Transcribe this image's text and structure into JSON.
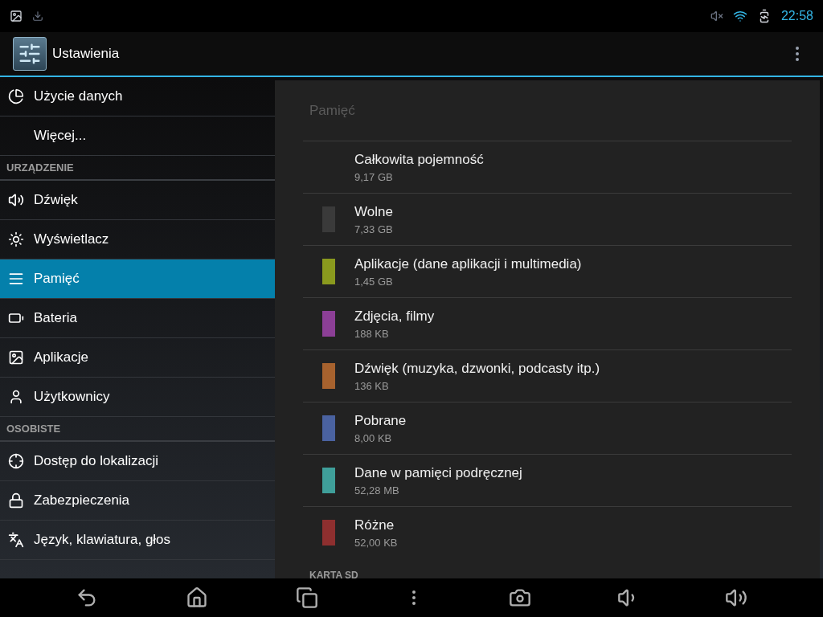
{
  "status_bar": {
    "time": "22:58"
  },
  "action_bar": {
    "title": "Ustawienia"
  },
  "sidebar": {
    "items": [
      {
        "kind": "item",
        "label": "Użycie danych",
        "selected": false
      },
      {
        "kind": "item",
        "label": "Więcej...",
        "selected": false
      },
      {
        "kind": "header",
        "label": "URZĄDZENIE"
      },
      {
        "kind": "item",
        "label": "Dźwięk",
        "selected": false
      },
      {
        "kind": "item",
        "label": "Wyświetlacz",
        "selected": false
      },
      {
        "kind": "item",
        "label": "Pamięć",
        "selected": true
      },
      {
        "kind": "item",
        "label": "Bateria",
        "selected": false
      },
      {
        "kind": "item",
        "label": "Aplikacje",
        "selected": false
      },
      {
        "kind": "item",
        "label": "Użytkownicy",
        "selected": false
      },
      {
        "kind": "header",
        "label": "OSOBISTE"
      },
      {
        "kind": "item",
        "label": "Dostęp do lokalizacji",
        "selected": false
      },
      {
        "kind": "item",
        "label": "Zabezpieczenia",
        "selected": false
      },
      {
        "kind": "item",
        "label": "Język, klawiatura, głos",
        "selected": false
      }
    ]
  },
  "storage": {
    "title": "Pamięć",
    "rows": [
      {
        "label": "Całkowita pojemność",
        "value": "9,17 GB"
      },
      {
        "label": "Wolne",
        "value": "7,33 GB",
        "color": "#3a3a3a"
      },
      {
        "label": "Aplikacje (dane aplikacji i multimedia)",
        "value": "1,45 GB",
        "color": "#8a9a1e"
      },
      {
        "label": "Zdjęcia, filmy",
        "value": "188 KB",
        "color": "#8c3f96"
      },
      {
        "label": "Dźwięk (muzyka, dzwonki, podcasty itp.)",
        "value": "136 KB",
        "color": "#a7622e"
      },
      {
        "label": "Pobrane",
        "value": "8,00 KB",
        "color": "#4a62a0"
      },
      {
        "label": "Dane w pamięci podręcznej",
        "value": "52,28 MB",
        "color": "#3f9f9a"
      },
      {
        "label": "Różne",
        "value": "52,00 KB",
        "color": "#8e2f2f"
      }
    ],
    "footer_header": "KARTA SD"
  }
}
